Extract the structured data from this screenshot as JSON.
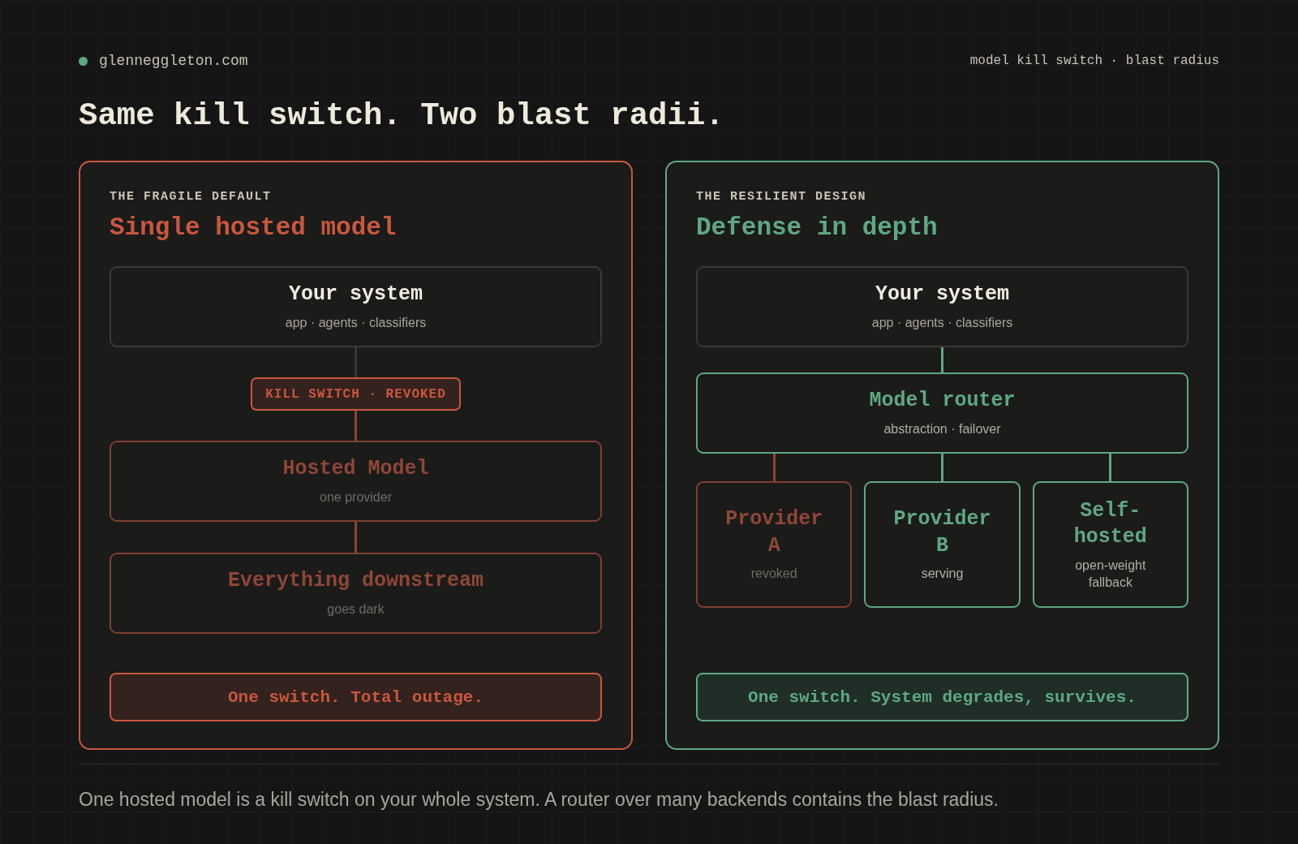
{
  "site": {
    "name": "glenneggleton.com"
  },
  "tagline": "model kill switch · blast radius",
  "title": "Same kill switch. Two blast radii.",
  "panels": [
    {
      "kind": "fragile",
      "eyebrow": "THE FRAGILE DEFAULT",
      "heading": "Single hosted model",
      "flow": [
        {
          "kind": "node",
          "revoked": false,
          "active": false,
          "title": "Your system",
          "subtitle": "app · agents · classifiers"
        },
        {
          "kind": "link",
          "revoked": false,
          "active": false
        },
        {
          "kind": "badge",
          "label": "KILL SWITCH · REVOKED"
        },
        {
          "kind": "link",
          "revoked": true,
          "active": false
        },
        {
          "kind": "node",
          "revoked": true,
          "active": false,
          "title": "Hosted Model",
          "subtitle": "one provider"
        },
        {
          "kind": "link",
          "revoked": true,
          "active": false
        },
        {
          "kind": "node",
          "revoked": true,
          "active": false,
          "title": "Everything downstream",
          "subtitle": "goes dark"
        }
      ],
      "summary": "One switch. Total outage."
    },
    {
      "kind": "resilient",
      "eyebrow": "THE RESILIENT DESIGN",
      "heading": "Defense in depth",
      "flow": [
        {
          "kind": "node",
          "revoked": false,
          "active": false,
          "title": "Your system",
          "subtitle": "app · agents · classifiers"
        },
        {
          "kind": "link",
          "revoked": false,
          "active": true
        },
        {
          "kind": "node",
          "revoked": false,
          "active": true,
          "title": "Model router",
          "subtitle": "abstraction · failover"
        },
        {
          "kind": "branch",
          "children": [
            {
              "revoked": true,
              "active": false,
              "title": "Provider A",
              "subtitle": "revoked"
            },
            {
              "revoked": false,
              "active": true,
              "title": "Provider B",
              "subtitle": "serving"
            },
            {
              "revoked": false,
              "active": true,
              "title": "Self-hosted",
              "subtitle": "open-weight fallback"
            }
          ]
        }
      ],
      "summary": "One switch. System degrades, survives."
    }
  ],
  "caption": "One hosted model is a kill switch on your whole system. A router over many backends contains the blast radius."
}
